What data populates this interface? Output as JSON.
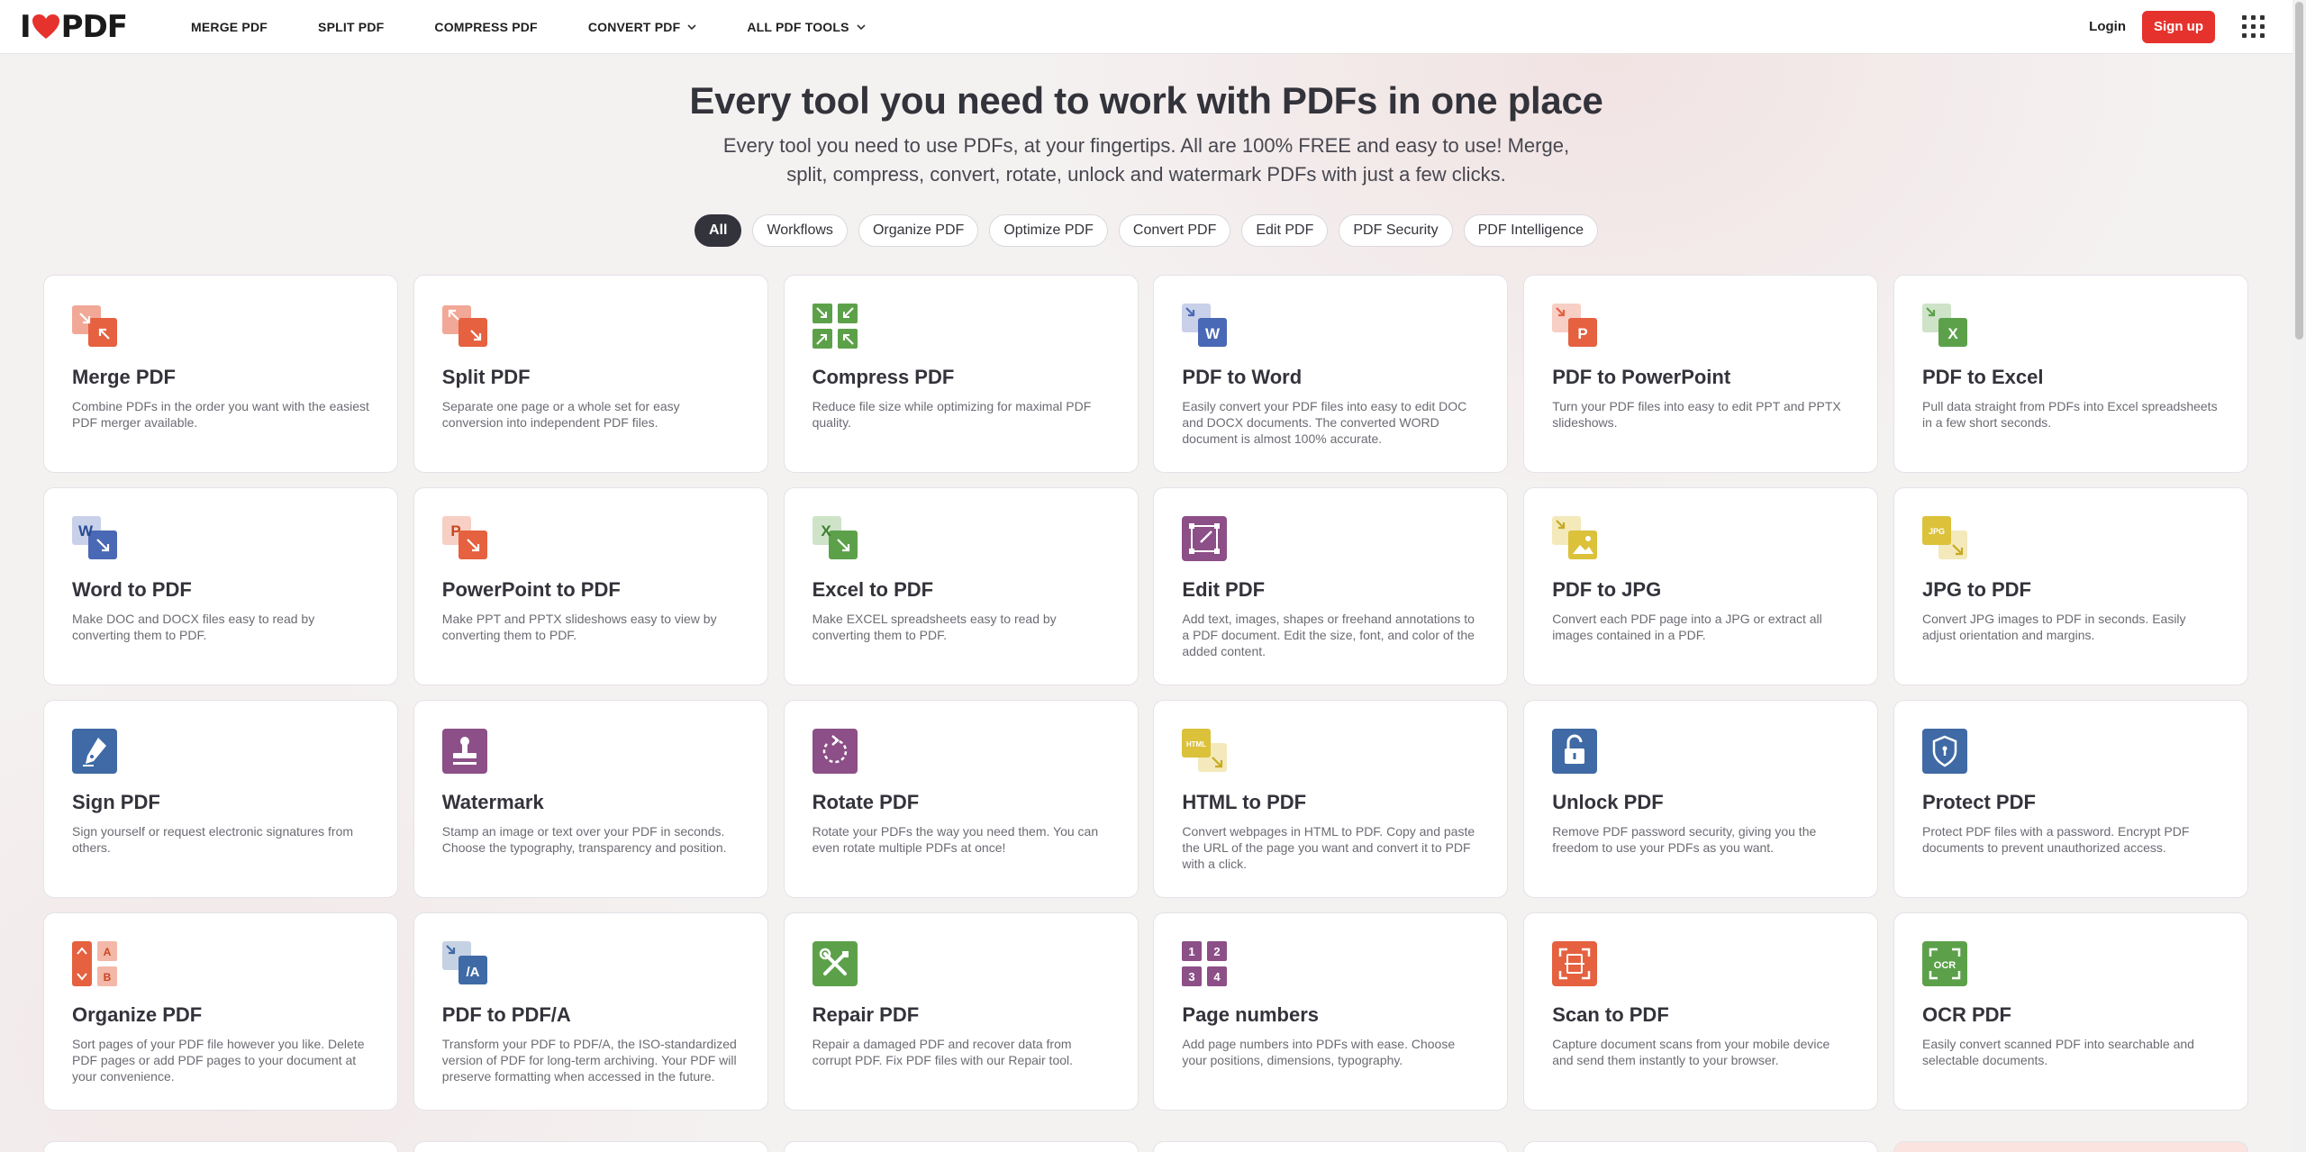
{
  "header": {
    "logo_text_left": "I",
    "logo_text_right": "PDF",
    "nav": [
      {
        "label": "MERGE PDF",
        "dropdown": false
      },
      {
        "label": "SPLIT PDF",
        "dropdown": false
      },
      {
        "label": "COMPRESS PDF",
        "dropdown": false
      },
      {
        "label": "CONVERT PDF",
        "dropdown": true
      },
      {
        "label": "ALL PDF TOOLS",
        "dropdown": true
      }
    ],
    "login": "Login",
    "signup": "Sign up"
  },
  "hero": {
    "title": "Every tool you need to work with PDFs in one place",
    "subtitle_line1": "Every tool you need to use PDFs, at your fingertips. All are 100% FREE and easy to use! Merge,",
    "subtitle_line2": "split, compress, convert, rotate, unlock and watermark PDFs with just a few clicks."
  },
  "filters": [
    "All",
    "Workflows",
    "Organize PDF",
    "Optimize PDF",
    "Convert PDF",
    "Edit PDF",
    "PDF Security",
    "PDF Intelligence"
  ],
  "active_filter": "All",
  "colors": {
    "brand_red": "#e5322d",
    "orange": "#e5613f",
    "green": "#5ca14a",
    "blue": "#4968b5",
    "purple": "#8c4f87",
    "yellow": "#dcc13a",
    "navy": "#3f6aa5"
  },
  "tools": [
    {
      "title": "Merge PDF",
      "desc": "Combine PDFs in the order you want with the easiest PDF merger available.",
      "icon": "merge-icon"
    },
    {
      "title": "Split PDF",
      "desc": "Separate one page or a whole set for easy conversion into independent PDF files.",
      "icon": "split-icon"
    },
    {
      "title": "Compress PDF",
      "desc": "Reduce file size while optimizing for maximal PDF quality.",
      "icon": "compress-icon"
    },
    {
      "title": "PDF to Word",
      "desc": "Easily convert your PDF files into easy to edit DOC and DOCX documents. The converted WORD document is almost 100% accurate.",
      "icon": "pdf-to-word-icon"
    },
    {
      "title": "PDF to PowerPoint",
      "desc": "Turn your PDF files into easy to edit PPT and PPTX slideshows.",
      "icon": "pdf-to-powerpoint-icon"
    },
    {
      "title": "PDF to Excel",
      "desc": "Pull data straight from PDFs into Excel spreadsheets in a few short seconds.",
      "icon": "pdf-to-excel-icon"
    },
    {
      "title": "Word to PDF",
      "desc": "Make DOC and DOCX files easy to read by converting them to PDF.",
      "icon": "word-to-pdf-icon"
    },
    {
      "title": "PowerPoint to PDF",
      "desc": "Make PPT and PPTX slideshows easy to view by converting them to PDF.",
      "icon": "powerpoint-to-pdf-icon"
    },
    {
      "title": "Excel to PDF",
      "desc": "Make EXCEL spreadsheets easy to read by converting them to PDF.",
      "icon": "excel-to-pdf-icon"
    },
    {
      "title": "Edit PDF",
      "desc": "Add text, images, shapes or freehand annotations to a PDF document. Edit the size, font, and color of the added content.",
      "icon": "edit-pdf-icon"
    },
    {
      "title": "PDF to JPG",
      "desc": "Convert each PDF page into a JPG or extract all images contained in a PDF.",
      "icon": "pdf-to-jpg-icon"
    },
    {
      "title": "JPG to PDF",
      "desc": "Convert JPG images to PDF in seconds. Easily adjust orientation and margins.",
      "icon": "jpg-to-pdf-icon"
    },
    {
      "title": "Sign PDF",
      "desc": "Sign yourself or request electronic signatures from others.",
      "icon": "sign-icon"
    },
    {
      "title": "Watermark",
      "desc": "Stamp an image or text over your PDF in seconds. Choose the typography, transparency and position.",
      "icon": "watermark-icon"
    },
    {
      "title": "Rotate PDF",
      "desc": "Rotate your PDFs the way you need them. You can even rotate multiple PDFs at once!",
      "icon": "rotate-icon"
    },
    {
      "title": "HTML to PDF",
      "desc": "Convert webpages in HTML to PDF. Copy and paste the URL of the page you want and convert it to PDF with a click.",
      "icon": "html-to-pdf-icon"
    },
    {
      "title": "Unlock PDF",
      "desc": "Remove PDF password security, giving you the freedom to use your PDFs as you want.",
      "icon": "unlock-icon"
    },
    {
      "title": "Protect PDF",
      "desc": "Protect PDF files with a password. Encrypt PDF documents to prevent unauthorized access.",
      "icon": "protect-icon"
    },
    {
      "title": "Organize PDF",
      "desc": "Sort pages of your PDF file however you like. Delete PDF pages or add PDF pages to your document at your convenience.",
      "icon": "organize-icon"
    },
    {
      "title": "PDF to PDF/A",
      "desc": "Transform your PDF to PDF/A, the ISO-standardized version of PDF for long-term archiving. Your PDF will preserve formatting when accessed in the future.",
      "icon": "pdf-to-pdfa-icon"
    },
    {
      "title": "Repair PDF",
      "desc": "Repair a damaged PDF and recover data from corrupt PDF. Fix PDF files with our Repair tool.",
      "icon": "repair-icon"
    },
    {
      "title": "Page numbers",
      "desc": "Add page numbers into PDFs with ease. Choose your positions, dimensions, typography.",
      "icon": "page-numbers-icon"
    },
    {
      "title": "Scan to PDF",
      "desc": "Capture document scans from your mobile device and send them instantly to your browser.",
      "icon": "scan-icon"
    },
    {
      "title": "OCR PDF",
      "desc": "Easily convert scanned PDF into searchable and selectable documents.",
      "icon": "ocr-icon"
    }
  ],
  "icon_text": {
    "word": "W",
    "ppt": "P",
    "excel": "X",
    "html": "HTML",
    "jpg": "JPG",
    "pdfa": "/A",
    "organize_a": "A",
    "organize_b": "B",
    "num1": "1",
    "num2": "2",
    "num3": "3",
    "num4": "4",
    "ocr": "OCR"
  }
}
